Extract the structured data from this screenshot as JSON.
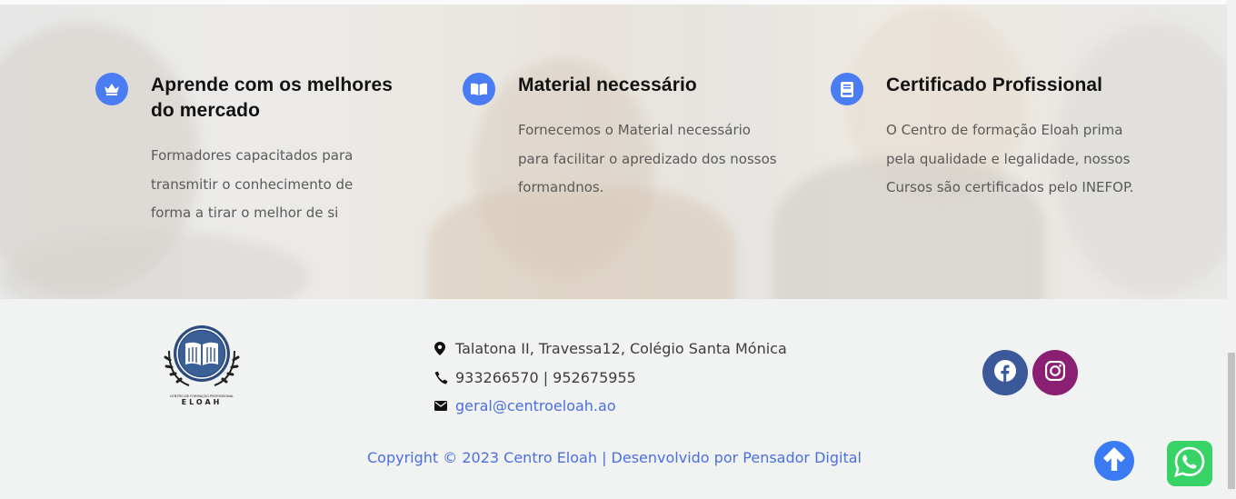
{
  "features": [
    {
      "icon": "crown-icon",
      "title": "Aprende com os melhores do mercado",
      "text": "Formadores capacitados para transmitir o conhecimento de forma a tirar o melhor de si"
    },
    {
      "icon": "book-open-icon",
      "title": "Material necessário",
      "text": "Fornecemos o Material necessário para facilitar o apredizado dos nossos formandnos."
    },
    {
      "icon": "book-icon",
      "title": "Certificado Profissional",
      "text": "O Centro de formação Eloah prima pela qualidade e legalidade, nossos Cursos são certificados pelo INEFOP."
    }
  ],
  "footer": {
    "logo": {
      "small_text": "CENTRO DE FORMAÇÃO PROFISSIONAL",
      "name": "ELOAH"
    },
    "address": "Talatona II, Travessa12, Colégio Santa Mónica",
    "phone": "933266570 | 952675955",
    "email": "geral@centroeloah.ao",
    "copyright": "Copyright © 2023 Centro Eloah | Desenvolvido por Pensador Digital"
  },
  "colors": {
    "accent": "#4a7cf4",
    "link": "#4a6fe0",
    "facebook": "#3b5998",
    "instagram": "#8a1f74",
    "whatsapp": "#37d366"
  }
}
